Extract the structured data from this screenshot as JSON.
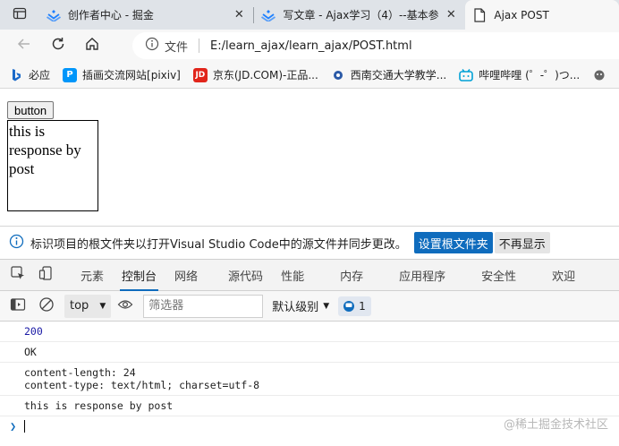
{
  "browser": {
    "tabs": [
      {
        "label": "创作者中心 - 掘金",
        "icon": "juejin-logo-icon",
        "active": false
      },
      {
        "label": "写文章 - Ajax学习（4）--基本参",
        "icon": "juejin-logo-icon",
        "active": false
      },
      {
        "label": "Ajax POST",
        "icon": "document-icon",
        "active": true
      }
    ],
    "address": {
      "site_label": "文件",
      "url": "E:/learn_ajax/learn_ajax/POST.html"
    },
    "favorites": [
      {
        "label": "必应",
        "icon": "bing-icon",
        "color": "#1b6ac9"
      },
      {
        "label": "插画交流网站[pixiv]",
        "icon": "pixiv-icon",
        "color": "#0096fa"
      },
      {
        "label": "京东(JD.COM)-正品...",
        "icon": "jd-icon",
        "color": "#e1251b"
      },
      {
        "label": "西南交通大学教学...",
        "icon": "swjtu-icon",
        "color": "#2b5aa7"
      },
      {
        "label": "哔哩哔哩 (゜-゜)つ...",
        "icon": "bilibili-icon",
        "color": "#00a1d6"
      }
    ]
  },
  "page": {
    "button_label": "button",
    "result_text": "this is response by post"
  },
  "infobar": {
    "message": "标识项目的根文件夹以打开Visual Studio Code中的源文件并同步更改。",
    "primary_label": "设置根文件夹",
    "secondary_label": "不再显示"
  },
  "devtools": {
    "tabs": [
      {
        "label": "元素",
        "active": false
      },
      {
        "label": "控制台",
        "active": true
      },
      {
        "label": "网络",
        "active": false
      },
      {
        "label": "源代码",
        "active": false
      },
      {
        "label": "性能",
        "active": false
      },
      {
        "label": "内存",
        "active": false
      },
      {
        "label": "应用程序",
        "active": false
      },
      {
        "label": "安全性",
        "active": false
      },
      {
        "label": "欢迎",
        "active": false
      }
    ],
    "toolbar": {
      "context": "top",
      "filter_placeholder": "筛选器",
      "level": "默认级别",
      "issues_count": "1"
    },
    "console": {
      "status": "200",
      "status_text": "OK",
      "headers": "content-length: 24\ncontent-type: text/html; charset=utf-8",
      "response": "this is response by post"
    }
  },
  "watermark": "@稀土掘金技术社区",
  "colors": {
    "accent": "#0f6cbd",
    "tabstrip": "#dfe3e8",
    "number": "#1a1aa6"
  }
}
